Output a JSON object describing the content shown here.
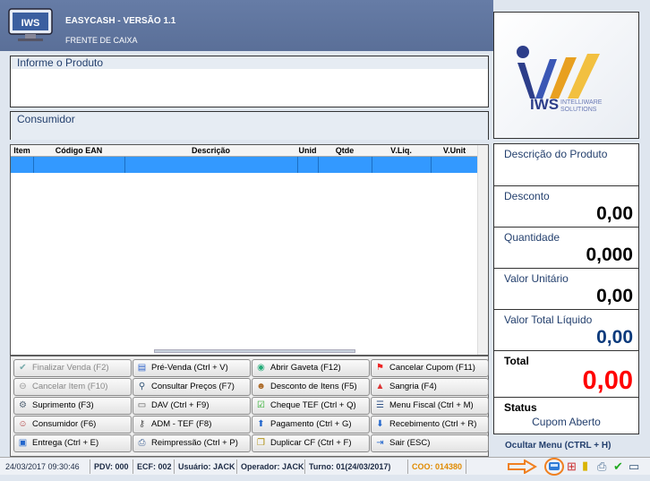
{
  "app": {
    "title": "EASYCASH - VERSÃO 1.1",
    "subtitle": "FRENTE DE CAIXA"
  },
  "logo": {
    "brand": "IWS",
    "tagline1": "INTELLIWARE",
    "tagline2": "SOLUTIONS"
  },
  "product_panel": {
    "label": "Informe o Produto"
  },
  "consumer_panel": {
    "label": "Consumidor"
  },
  "grid": {
    "columns": [
      "Item",
      "Código EAN",
      "Descrição",
      "Unid",
      "Qtde",
      "V.Liq.",
      "V.Unit"
    ]
  },
  "info": {
    "descricao_label": "Descrição do Produto",
    "desconto_label": "Desconto",
    "desconto_value": "0,00",
    "quantidade_label": "Quantidade",
    "quantidade_value": "0,000",
    "valor_unitario_label": "Valor Unitário",
    "valor_unitario_value": "0,00",
    "valor_total_label": "Valor Total Líquido",
    "valor_total_value": "0,00",
    "total_label": "Total",
    "total_value": "0,00",
    "status_label": "Status",
    "status_value": "Cupom Aberto"
  },
  "buttons": [
    {
      "label": "Finalizar Venda (F2)",
      "icon": "check-icon",
      "enabled": false
    },
    {
      "label": "Pré-Venda (Ctrl + V)",
      "icon": "document-icon",
      "enabled": true
    },
    {
      "label": "Abrir Gaveta (F12)",
      "icon": "globe-icon",
      "enabled": true
    },
    {
      "label": "Cancelar Cupom (F11)",
      "icon": "red-flag-icon",
      "enabled": true
    },
    {
      "label": "Cancelar Item (F10)",
      "icon": "minus-circle-icon",
      "enabled": false
    },
    {
      "label": "Consultar Preços (F7)",
      "icon": "magnifier-icon",
      "enabled": true
    },
    {
      "label": "Desconto de Itens (F5)",
      "icon": "people-icon",
      "enabled": true
    },
    {
      "label": "Sangria (F4)",
      "icon": "warning-icon",
      "enabled": true
    },
    {
      "label": "Suprimento (F3)",
      "icon": "gear-icon",
      "enabled": true
    },
    {
      "label": "DAV (Ctrl + F9)",
      "icon": "page-icon",
      "enabled": true
    },
    {
      "label": "Cheque TEF (Ctrl + Q)",
      "icon": "check-document-icon",
      "enabled": true
    },
    {
      "label": "Menu Fiscal (Ctrl + M)",
      "icon": "list-icon",
      "enabled": true
    },
    {
      "label": "Consumidor (F6)",
      "icon": "user-icon",
      "enabled": true
    },
    {
      "label": "ADM - TEF (F8)",
      "icon": "key-icon",
      "enabled": true
    },
    {
      "label": "Pagamento (Ctrl + G)",
      "icon": "arrow-up-icon",
      "enabled": true
    },
    {
      "label": "Recebimento (Ctrl + R)",
      "icon": "arrow-down-icon",
      "enabled": true
    },
    {
      "label": "Entrega (Ctrl + E)",
      "icon": "truck-icon",
      "enabled": true
    },
    {
      "label": "Reimpressão (Ctrl + P)",
      "icon": "printer-icon",
      "enabled": true
    },
    {
      "label": "Duplicar CF (Ctrl + F)",
      "icon": "copy-icon",
      "enabled": true
    },
    {
      "label": "Sair (ESC)",
      "icon": "exit-icon",
      "enabled": true
    }
  ],
  "menu_toggle": "Ocultar Menu (CTRL + H)",
  "status_bar": {
    "datetime": "24/03/2017 09:30:46",
    "pdv": "PDV: 000",
    "ecf": "ECF: 002",
    "usuario": "Usuário: JACK",
    "operador": "Operador: JACK",
    "turno": "Turno: 01(24/03/2017)",
    "coo": "COO: 014380"
  },
  "tray_icons": [
    "arrow-right-icon",
    "bus-icon",
    "gift-icon",
    "database-icon",
    "printer-icon",
    "check-circle-icon",
    "monitor-icon"
  ],
  "colors": {
    "header": "#5a6f98",
    "selection": "#3399ff",
    "total_red": "#ff0000",
    "valor_total_blue": "#0b3a7c",
    "coo_orange": "#e08a00",
    "arrow_orange": "#f08020"
  }
}
